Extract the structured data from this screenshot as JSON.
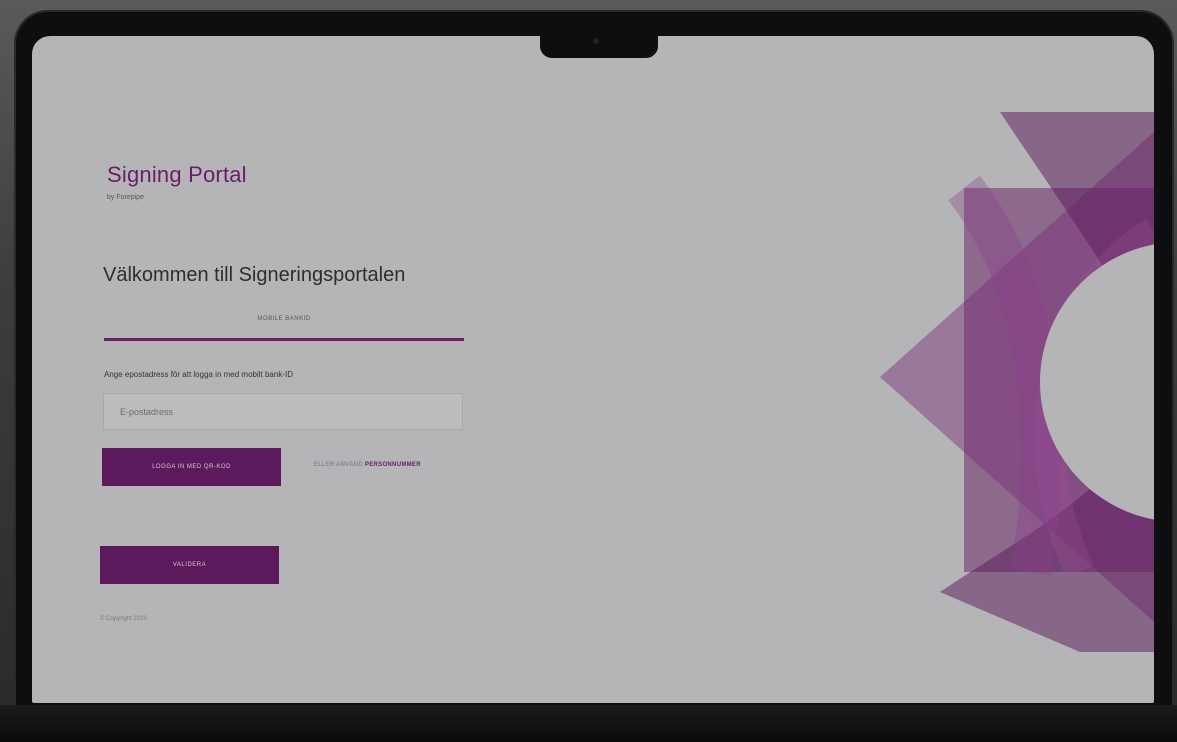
{
  "brand": {
    "title": "Signing Portal",
    "subtitle": "by Forepipe"
  },
  "welcome_heading": "Välkommen till Signeringsportalen",
  "tabs": [
    {
      "label": "MOBILE BANKID",
      "active": true
    }
  ],
  "login_form": {
    "instruction": "Ange epostadress för att logga in med mobilt bank-ID",
    "email_placeholder": "E-postadress",
    "email_value": "",
    "qr_button_label": "LOGGA IN MED QR-KOD",
    "alt_link_prefix": "ELLER ANVÄND",
    "alt_link_bold": "PERSONNUMMER",
    "validate_button_label": "VALIDERA"
  },
  "footer": {
    "copyright": "© Copyright 2023"
  },
  "colors": {
    "brand_purple": "#6a1e6a",
    "button_purple": "#5c1a5c",
    "screen_background": "#b5b5b7",
    "bezel": "#0e0e10"
  },
  "icons": {
    "decorative_art": "purple-geometric-star-shape"
  }
}
